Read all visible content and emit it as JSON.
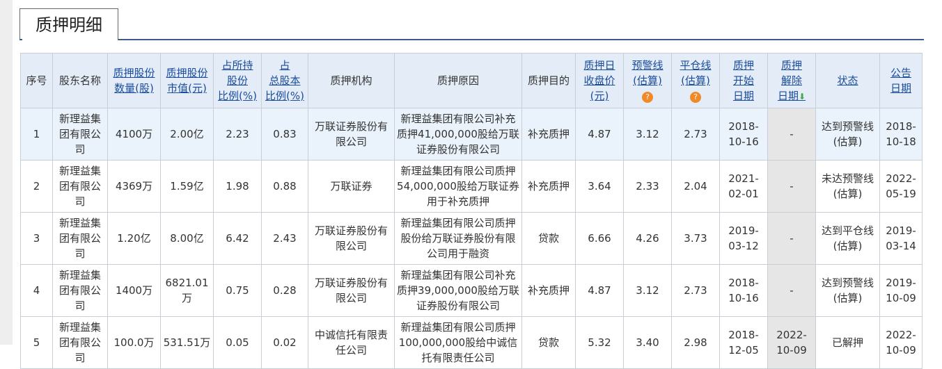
{
  "page": {
    "title": "质押明细"
  },
  "table": {
    "headers": [
      {
        "key": "seq",
        "lines": [
          "序号"
        ],
        "link": false
      },
      {
        "key": "holder",
        "lines": [
          "股东名称"
        ],
        "link": false
      },
      {
        "key": "shares",
        "lines": [
          "质押股份",
          "数量(股)"
        ],
        "link": true
      },
      {
        "key": "value",
        "lines": [
          "质押股份",
          "市值(元)"
        ],
        "link": true
      },
      {
        "key": "pct_hold",
        "lines": [
          "占所持",
          "股份",
          "比例(%)"
        ],
        "link": true
      },
      {
        "key": "pct_total",
        "lines": [
          "占",
          "总股本",
          "比例(%)"
        ],
        "link": true
      },
      {
        "key": "org",
        "lines": [
          "质押机构"
        ],
        "link": false
      },
      {
        "key": "reason",
        "lines": [
          "质押原因"
        ],
        "link": false
      },
      {
        "key": "purpose",
        "lines": [
          "质押目的"
        ],
        "link": false
      },
      {
        "key": "close",
        "lines": [
          "质押日",
          "收盘价",
          "(元)"
        ],
        "link": true
      },
      {
        "key": "warn",
        "lines": [
          "预警线",
          "(估算)"
        ],
        "link": true,
        "help": "?"
      },
      {
        "key": "liq",
        "lines": [
          "平仓线",
          "(估算)"
        ],
        "link": true,
        "help": "?"
      },
      {
        "key": "start",
        "lines": [
          "质押",
          "开始",
          "日期"
        ],
        "link": true
      },
      {
        "key": "release",
        "lines": [
          "质押",
          "解除",
          "日期"
        ],
        "link": true,
        "sort": "sort-down-icon"
      },
      {
        "key": "status",
        "lines": [
          "状态"
        ],
        "link": true
      },
      {
        "key": "announce",
        "lines": [
          "公告",
          "日期"
        ],
        "link": true
      }
    ],
    "rows": [
      {
        "seq": "1",
        "holder": "新理益集团有限公司",
        "shares": "4100万",
        "value": "2.00亿",
        "pct_hold": "2.23",
        "pct_total": "0.83",
        "org": "万联证券股份有限公司",
        "reason": "新理益集团有限公司补充质押41,000,000股给万联证券股份有限公司",
        "purpose": "补充质押",
        "close": "4.87",
        "warn": "3.12",
        "liq": "2.73",
        "start": "2018-10-16",
        "release": "-",
        "status": "达到预警线(估算)",
        "announce": "2018-10-18",
        "highlight": true
      },
      {
        "seq": "2",
        "holder": "新理益集团有限公司",
        "shares": "4369万",
        "value": "1.59亿",
        "pct_hold": "1.98",
        "pct_total": "0.88",
        "org": "万联证券",
        "reason": "新理益集团有限公司质押54,000,000股给万联证券用于补充质押",
        "purpose": "补充质押",
        "close": "3.64",
        "warn": "2.33",
        "liq": "2.04",
        "start": "2021-02-01",
        "release": "-",
        "status": "未达预警线(估算)",
        "announce": "2022-05-19",
        "highlight": false
      },
      {
        "seq": "3",
        "holder": "新理益集团有限公司",
        "shares": "1.20亿",
        "value": "8.00亿",
        "pct_hold": "6.42",
        "pct_total": "2.43",
        "org": "万联证券股份有限公司",
        "reason": "新理益集团有限公司质押股份给万联证券股份有限公司用于融资",
        "purpose": "贷款",
        "close": "6.66",
        "warn": "4.26",
        "liq": "3.73",
        "start": "2019-03-12",
        "release": "-",
        "status": "达到平仓线(估算)",
        "announce": "2019-03-14",
        "highlight": false
      },
      {
        "seq": "4",
        "holder": "新理益集团有限公司",
        "shares": "1400万",
        "value": "6821.01万",
        "pct_hold": "0.75",
        "pct_total": "0.28",
        "org": "万联证券股份有限公司",
        "reason": "新理益集团有限公司补充质押39,000,000股给万联证券股份有限公司",
        "purpose": "补充质押",
        "close": "4.87",
        "warn": "3.12",
        "liq": "2.73",
        "start": "2018-10-16",
        "release": "-",
        "status": "达到预警线(估算)",
        "announce": "2019-10-09",
        "highlight": false
      },
      {
        "seq": "5",
        "holder": "新理益集团有限公司",
        "shares": "100.0万",
        "value": "531.51万",
        "pct_hold": "0.05",
        "pct_total": "0.02",
        "org": "中诚信托有限责任公司",
        "reason": "新理益集团有限公司质押100,000,000股给中诚信托有限责任公司",
        "purpose": "贷款",
        "close": "5.32",
        "warn": "3.40",
        "liq": "2.98",
        "start": "2018-12-05",
        "release": "2022-10-09",
        "status": "已解押",
        "announce": "2022-10-09",
        "highlight": false
      }
    ]
  }
}
